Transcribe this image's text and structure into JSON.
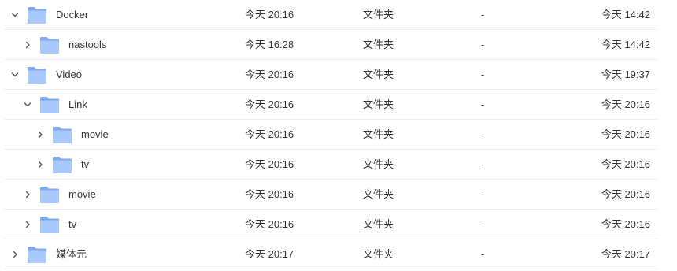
{
  "icons": {
    "folder": "folder-icon",
    "expanded": "chevron-down-icon",
    "collapsed": "chevron-right-icon"
  },
  "colors": {
    "folder_back": "#7fa9f0",
    "folder_front": "#a9c8fb",
    "chevron": "#555555",
    "divider": "#eeeeee",
    "text": "#333333"
  },
  "rows": [
    {
      "name": "Docker",
      "depth": 0,
      "expanded": true,
      "created": "今天 20:16",
      "type": "文件夹",
      "size": "-",
      "modified": "今天 14:42"
    },
    {
      "name": "nastools",
      "depth": 1,
      "expanded": false,
      "created": "今天 16:28",
      "type": "文件夹",
      "size": "-",
      "modified": "今天 14:42"
    },
    {
      "name": "Video",
      "depth": 0,
      "expanded": true,
      "created": "今天 20:16",
      "type": "文件夹",
      "size": "-",
      "modified": "今天 19:37"
    },
    {
      "name": "Link",
      "depth": 1,
      "expanded": true,
      "created": "今天 20:16",
      "type": "文件夹",
      "size": "-",
      "modified": "今天 20:16"
    },
    {
      "name": "movie",
      "depth": 2,
      "expanded": false,
      "created": "今天 20:16",
      "type": "文件夹",
      "size": "-",
      "modified": "今天 20:16"
    },
    {
      "name": "tv",
      "depth": 2,
      "expanded": false,
      "created": "今天 20:16",
      "type": "文件夹",
      "size": "-",
      "modified": "今天 20:16"
    },
    {
      "name": "movie",
      "depth": 1,
      "expanded": false,
      "created": "今天 20:16",
      "type": "文件夹",
      "size": "-",
      "modified": "今天 20:16"
    },
    {
      "name": "tv",
      "depth": 1,
      "expanded": false,
      "created": "今天 20:16",
      "type": "文件夹",
      "size": "-",
      "modified": "今天 20:16"
    },
    {
      "name": "媒体元",
      "depth": 0,
      "expanded": false,
      "created": "今天 20:17",
      "type": "文件夹",
      "size": "-",
      "modified": "今天 20:17"
    }
  ]
}
